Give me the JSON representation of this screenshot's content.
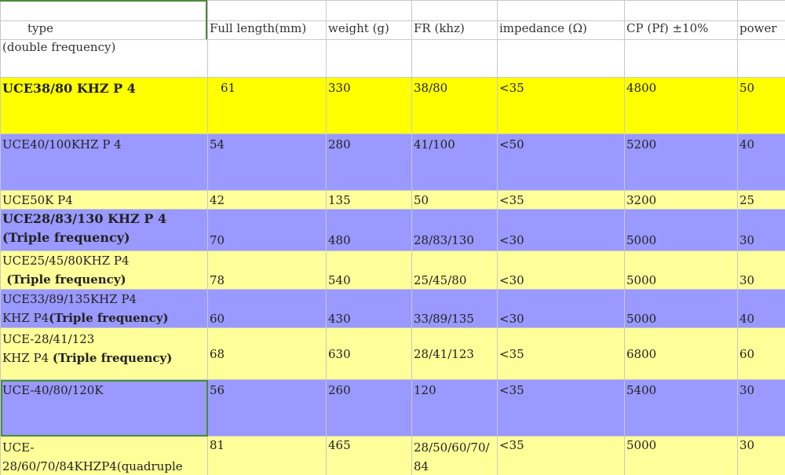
{
  "header": {
    "type_line1": "type",
    "type_line2": "(double  frequency)",
    "full_length": "Full length(mm)",
    "weight": "weight (g)",
    "fr": "FR  (khz)",
    "impedance": "impedance (Ω)",
    "cp": "CP (Pf) ±10%",
    "power": "power"
  },
  "rows": [
    {
      "type1": "UCE38/80 KHZ P 4",
      "length": "61",
      "weight": "330",
      "fr": "38/80",
      "impedance": "<35",
      "cp": "4800",
      "power": "50"
    },
    {
      "type1": "UCE40/100KHZ P 4",
      "length": "54",
      "weight": "280",
      "fr": "41/100",
      "impedance": "<50",
      "cp": "5200",
      "power": "40"
    },
    {
      "type1": "UCE50K P4",
      "length": "42",
      "weight": "135",
      "fr": "50",
      "impedance": "<35",
      "cp": "3200",
      "power": "25"
    },
    {
      "type1": "UCE28/83/130 KHZ P 4",
      "type2": "(Triple frequency)",
      "length": "70",
      "weight": "480",
      "fr": "28/83/130",
      "impedance": "<30",
      "cp": "5000",
      "power": "30"
    },
    {
      "type1": "UCE25/45/80KHZ P4",
      "type2": " (Triple frequency)",
      "length": "78",
      "weight": "540",
      "fr": "25/45/80",
      "impedance": "<30",
      "cp": "5000",
      "power": "30"
    },
    {
      "type1": "UCE33/89/135KHZ P4",
      "type2a": "KHZ P4",
      "type2b": "(Triple frequency)",
      "length": "60",
      "weight": "430",
      "fr": "33/89/135",
      "impedance": "<30",
      "cp": "5000",
      "power": "40"
    },
    {
      "type1": "UCE-28/41/123",
      "type2a": "KHZ P4 ",
      "type2b": "(Triple frequency)",
      "length": "68",
      "weight": "630",
      "fr": "28/41/123",
      "impedance": "<35",
      "cp": "6800",
      "power": "60"
    },
    {
      "type1": "UCE-40/80/120K",
      "length": "56",
      "weight": "260",
      "fr": "120",
      "impedance": "<35",
      "cp": "5400",
      "power": "30"
    },
    {
      "type1": "UCE-",
      "type2": "28/60/70/84KHZP4(quadruple",
      "length": "81",
      "weight": "465",
      "fr": "28/50/60/70/84",
      "impedance": "<35",
      "cp": "5000",
      "power": "30"
    }
  ],
  "colors": {
    "yellow": "#ffff00",
    "light_yellow": "#ffff99",
    "purple": "#9999ff"
  }
}
